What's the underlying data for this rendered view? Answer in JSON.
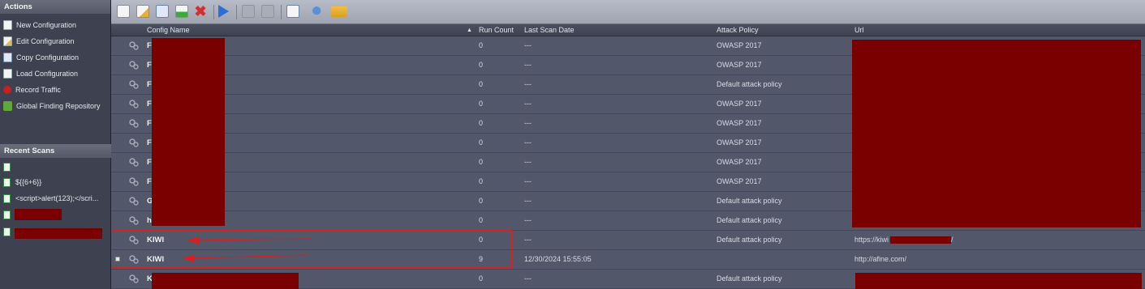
{
  "sidebar": {
    "actions_title": "Actions",
    "actions": [
      {
        "label": "New Configuration",
        "icon": "new-configuration-icon"
      },
      {
        "label": "Edit Configuration",
        "icon": "edit-configuration-icon"
      },
      {
        "label": "Copy Configuration",
        "icon": "copy-configuration-icon"
      },
      {
        "label": "Load Configuration",
        "icon": "load-configuration-icon"
      },
      {
        "label": "Record Traffic",
        "icon": "record-traffic-icon"
      },
      {
        "label": "Global Finding Repository",
        "icon": "global-finding-repository-icon"
      }
    ],
    "recent_title": "Recent Scans",
    "recent": [
      {
        "label": ""
      },
      {
        "label": "${{6+6}}"
      },
      {
        "label": "<script>alert(123);</scri..."
      },
      {
        "label": ""
      },
      {
        "label": ""
      }
    ]
  },
  "toolbar": {
    "icons": [
      "new-icon",
      "edit-icon",
      "copy-icon",
      "add-icon",
      "delete-icon",
      "run-icon",
      "pause-icon",
      "stop-icon",
      "report-icon",
      "search-icon",
      "open-folder-icon"
    ]
  },
  "grid": {
    "columns": {
      "config_name": "Config Name",
      "run_count": "Run Count",
      "last_scan": "Last Scan Date",
      "attack_policy": "Attack Policy",
      "url": "Url"
    },
    "rows": [
      {
        "name": "F",
        "runs": "0",
        "last": "---",
        "policy": "OWASP 2017",
        "url": ""
      },
      {
        "name": "F",
        "runs": "0",
        "last": "---",
        "policy": "OWASP 2017",
        "url": ""
      },
      {
        "name": "F",
        "runs": "0",
        "last": "---",
        "policy": "Default attack policy",
        "url": ""
      },
      {
        "name": "F",
        "runs": "0",
        "last": "---",
        "policy": "OWASP 2017",
        "url": ""
      },
      {
        "name": "F",
        "runs": "0",
        "last": "---",
        "policy": "OWASP 2017",
        "url": ""
      },
      {
        "name": "F",
        "runs": "0",
        "last": "---",
        "policy": "OWASP 2017",
        "url": ""
      },
      {
        "name": "F",
        "runs": "0",
        "last": "---",
        "policy": "OWASP 2017",
        "url": ""
      },
      {
        "name": "F",
        "runs": "0",
        "last": "---",
        "policy": "OWASP 2017",
        "url": ""
      },
      {
        "name": "G",
        "runs": "0",
        "last": "---",
        "policy": "Default attack policy",
        "url": ""
      },
      {
        "name": "h",
        "runs": "0",
        "last": "---",
        "policy": "Default attack policy",
        "url": ""
      },
      {
        "name": "KIWI",
        "runs": "0",
        "last": "---",
        "policy": "Default attack policy",
        "url": "https://kiwi",
        "url_tail": "/"
      },
      {
        "name": "KIWI",
        "runs": "9",
        "last": "12/30/2024 15:55:05",
        "policy": "",
        "url": "http://afine.com/"
      },
      {
        "name": "K",
        "runs": "0",
        "last": "---",
        "policy": "Default attack policy",
        "url": ""
      }
    ]
  },
  "colors": {
    "redaction": "#7a0000",
    "annotation": "#d42020"
  }
}
